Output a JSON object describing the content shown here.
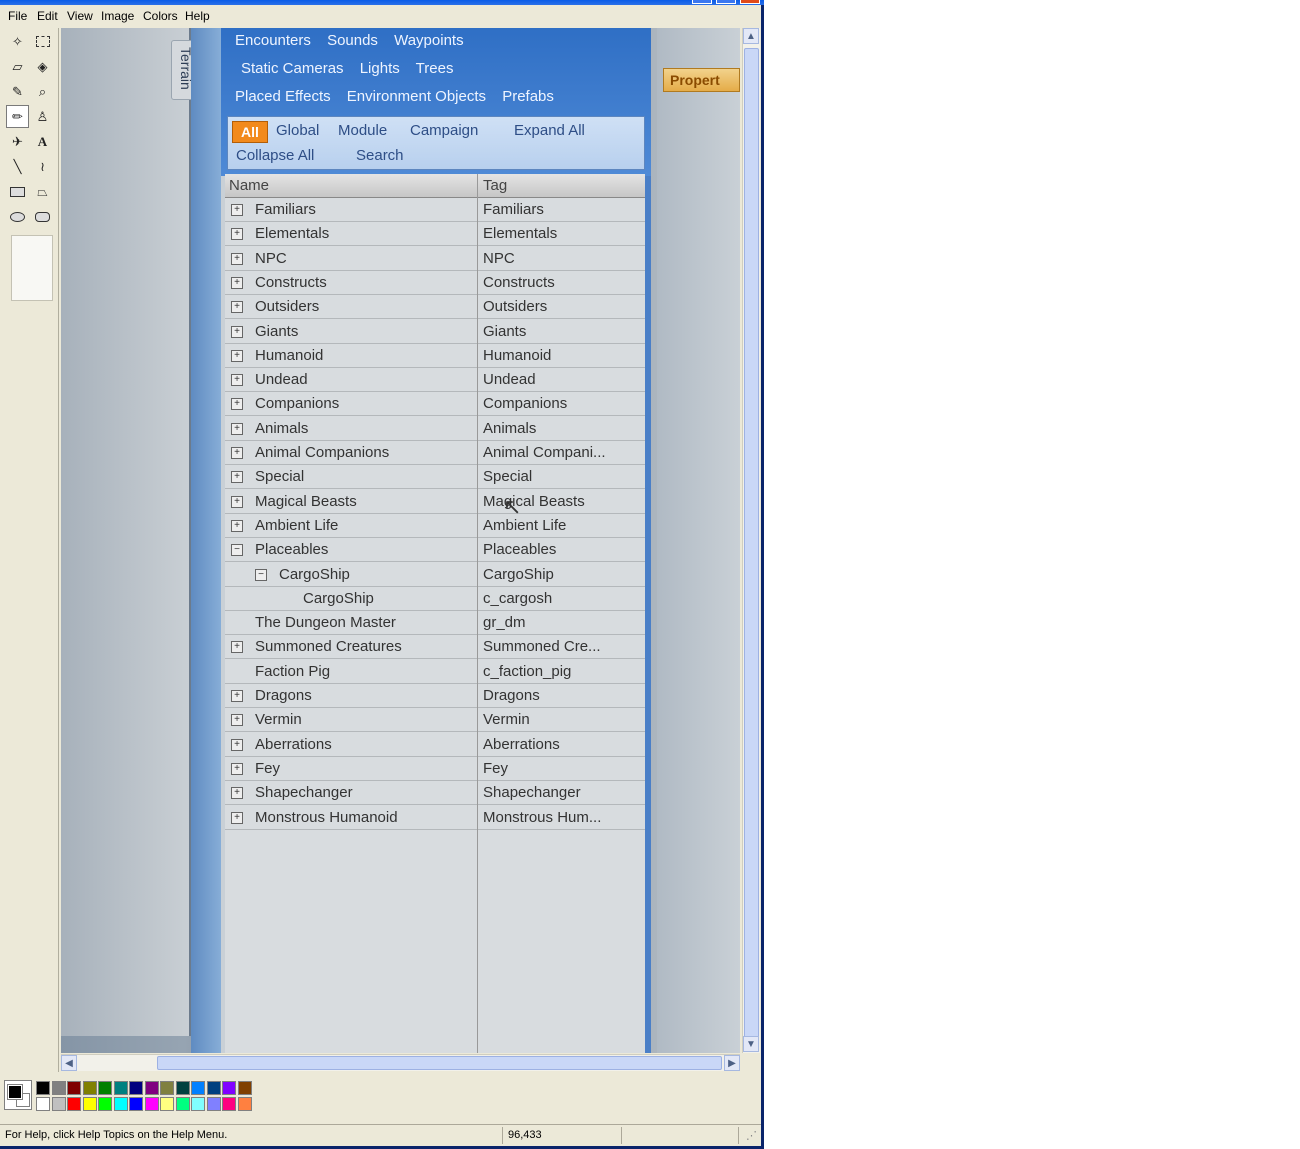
{
  "menu": [
    "File",
    "Edit",
    "View",
    "Image",
    "Colors",
    "Help"
  ],
  "tools": [
    "free-select-icon",
    "rect-select-icon",
    "eraser-icon",
    "fill-icon",
    "color-picker-icon",
    "magnifier-icon",
    "pencil-icon",
    "brush-icon",
    "airbrush-icon",
    "text-icon",
    "line-icon",
    "curve-icon",
    "rectangle-icon",
    "polygon-icon",
    "ellipse-icon",
    "rounded-rect-icon"
  ],
  "photo": {
    "terrain_tab": "Terrain",
    "tabs_row1": [
      "Encounters",
      "Sounds",
      "Waypoints"
    ],
    "tabs_row2": [
      "Static Cameras",
      "Lights",
      "Trees"
    ],
    "tabs_row3": [
      "Placed Effects",
      "Environment Objects",
      "Prefabs"
    ],
    "filters_row1": [
      "All",
      "Global",
      "Module",
      "Campaign",
      "Expand All"
    ],
    "filters_row2": [
      "Collapse All",
      "Search"
    ],
    "columns": {
      "name": "Name",
      "tag": "Tag"
    },
    "rows": [
      {
        "name": "Familiars",
        "tag": "Familiars",
        "exp": "+",
        "indent": 0
      },
      {
        "name": "Elementals",
        "tag": "Elementals",
        "exp": "+",
        "indent": 0
      },
      {
        "name": "NPC",
        "tag": "NPC",
        "exp": "+",
        "indent": 0
      },
      {
        "name": "Constructs",
        "tag": "Constructs",
        "exp": "+",
        "indent": 0
      },
      {
        "name": "Outsiders",
        "tag": "Outsiders",
        "exp": "+",
        "indent": 0
      },
      {
        "name": "Giants",
        "tag": "Giants",
        "exp": "+",
        "indent": 0
      },
      {
        "name": "Humanoid",
        "tag": "Humanoid",
        "exp": "+",
        "indent": 0
      },
      {
        "name": "Undead",
        "tag": "Undead",
        "exp": "+",
        "indent": 0
      },
      {
        "name": "Companions",
        "tag": "Companions",
        "exp": "+",
        "indent": 0
      },
      {
        "name": "Animals",
        "tag": "Animals",
        "exp": "+",
        "indent": 0
      },
      {
        "name": "Animal Companions",
        "tag": "Animal Compani...",
        "exp": "+",
        "indent": 0
      },
      {
        "name": "Special",
        "tag": "Special",
        "exp": "+",
        "indent": 0
      },
      {
        "name": "Magical Beasts",
        "tag": "Magical Beasts",
        "exp": "+",
        "indent": 0
      },
      {
        "name": "Ambient Life",
        "tag": "Ambient Life",
        "exp": "+",
        "indent": 0
      },
      {
        "name": "Placeables",
        "tag": "Placeables",
        "exp": "−",
        "indent": 0
      },
      {
        "name": "CargoShip",
        "tag": "CargoShip",
        "exp": "−",
        "indent": 1
      },
      {
        "name": "CargoShip",
        "tag": "c_cargosh",
        "exp": "",
        "indent": 2
      },
      {
        "name": "The Dungeon Master",
        "tag": "gr_dm",
        "exp": "",
        "indent": 0
      },
      {
        "name": "Summoned Creatures",
        "tag": "Summoned Cre...",
        "exp": "+",
        "indent": 0
      },
      {
        "name": "Faction Pig",
        "tag": "c_faction_pig",
        "exp": "",
        "indent": 0
      },
      {
        "name": "Dragons",
        "tag": "Dragons",
        "exp": "+",
        "indent": 0
      },
      {
        "name": "Vermin",
        "tag": "Vermin",
        "exp": "+",
        "indent": 0
      },
      {
        "name": "Aberrations",
        "tag": "Aberrations",
        "exp": "+",
        "indent": 0
      },
      {
        "name": "Fey",
        "tag": "Fey",
        "exp": "+",
        "indent": 0
      },
      {
        "name": "Shapechanger",
        "tag": "Shapechanger",
        "exp": "+",
        "indent": 0
      },
      {
        "name": "Monstrous Humanoid",
        "tag": "Monstrous Hum...",
        "exp": "+",
        "indent": 0
      }
    ],
    "properties_tab": "Propert"
  },
  "palette_top": [
    "#000000",
    "#808080",
    "#800000",
    "#808000",
    "#008000",
    "#008080",
    "#000080",
    "#800080",
    "#808040",
    "#004040",
    "#0080ff",
    "#004080",
    "#8000ff",
    "#804000"
  ],
  "palette_bottom": [
    "#ffffff",
    "#c0c0c0",
    "#ff0000",
    "#ffff00",
    "#00ff00",
    "#00ffff",
    "#0000ff",
    "#ff00ff",
    "#ffff80",
    "#00ff80",
    "#80ffff",
    "#8080ff",
    "#ff0080",
    "#ff8040"
  ],
  "status": {
    "help": "For Help, click Help Topics on the Help Menu.",
    "coords": "96,433"
  }
}
